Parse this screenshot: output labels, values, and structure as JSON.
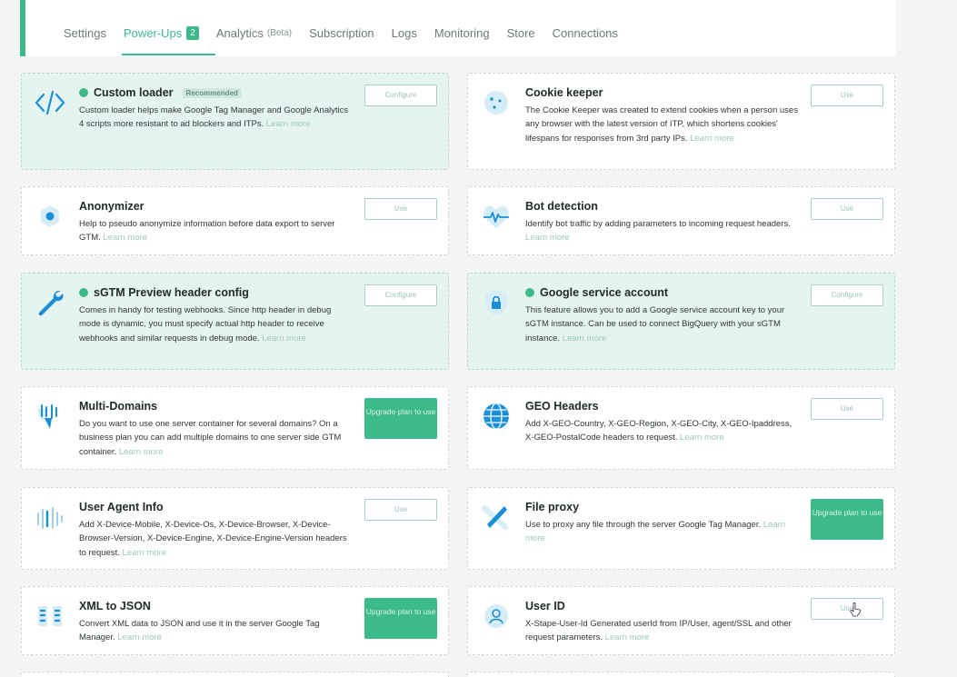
{
  "tabs": [
    {
      "label": "Settings"
    },
    {
      "label": "Power-Ups",
      "badge": "2"
    },
    {
      "label": "Analytics",
      "suffix": "(Beta)"
    },
    {
      "label": "Subscription"
    },
    {
      "label": "Logs"
    },
    {
      "label": "Monitoring"
    },
    {
      "label": "Store"
    },
    {
      "label": "Connections"
    }
  ],
  "active_tab": "Power-Ups",
  "colors": {
    "accent": "#3dba8a",
    "active_card_bg": "#e6f4f0",
    "blue_icon": "#1a8fd8"
  },
  "learn_more": "Learn more",
  "cards": [
    {
      "title": "Custom loader",
      "tag": "Recommended",
      "status": "enabled",
      "icon": "code-icon",
      "desc": "Custom loader helps make Google Tag Manager and Google Analytics 4 scripts more resistant to ad blockers and ITPs.",
      "button": "Configure"
    },
    {
      "title": "Cookie keeper",
      "status": "disabled",
      "icon": "cookie-icon",
      "desc": "The Cookie Keeper was created to extend cookies when a person uses any browser with the latest version of ITP, which shortens cookies' lifespans for responses from 3rd party IPs.",
      "button": "Use"
    },
    {
      "title": "Anonymizer",
      "status": "disabled",
      "icon": "anonymizer-icon",
      "desc": "Help to pseudo anonymize information before data export to server GTM.",
      "button": "Use"
    },
    {
      "title": "Bot detection",
      "status": "disabled",
      "icon": "heartbeat-icon",
      "desc": "Identify bot traffic by adding parameters to incoming request headers.",
      "button": "Use"
    },
    {
      "title": "sGTM Preview header config",
      "status": "enabled",
      "icon": "wrench-icon",
      "desc": "Comes in handy for testing webhooks. Since http header in debug mode is dynamic, you must specify actual http header to receive webhooks and similar requests in debug mode.",
      "button": "Configure"
    },
    {
      "title": "Google service account",
      "status": "enabled",
      "icon": "shield-lock-icon",
      "desc": "This feature allows you to add a Google service account key to your sGTM instance. Can be used to connect BigQuery with your sGTM instance.",
      "button": "Configure"
    },
    {
      "title": "Multi-Domains",
      "status": "locked",
      "icon": "multi-domains-icon",
      "desc": "Do you want to use one server container for several domains? On a business plan you can add multiple domains to one server side GTM container.",
      "button": "Upgrade plan to use"
    },
    {
      "title": "GEO Headers",
      "status": "disabled",
      "icon": "globe-icon",
      "desc": "Add X-GEO-Country, X-GEO-Region, X-GEO-City, X-GEO-Ipaddress, X-GEO-PostalCode headers to request.",
      "button": "Use"
    },
    {
      "title": "User Agent Info",
      "status": "disabled",
      "icon": "user-agent-icon",
      "desc": "Add X-Device-Mobile, X-Device-Os, X-Device-Browser, X-Device-Browser-Version, X-Device-Engine, X-Device-Engine-Version headers to request.",
      "button": "Use"
    },
    {
      "title": "File proxy",
      "status": "locked",
      "icon": "file-proxy-icon",
      "desc": "Use to proxy any file through the server Google Tag Manager.",
      "button": "Upgrade plan to use"
    },
    {
      "title": "XML to JSON",
      "status": "locked",
      "icon": "xml-json-icon",
      "desc": "Convert XML data to JSON and use it in the server Google Tag Manager.",
      "button": "Upgrade plan to use"
    },
    {
      "title": "User ID",
      "status": "disabled",
      "icon": "user-id-icon",
      "desc": "X-Stape-User-Id Generated userId from IP/User, agent/SSL and other request parameters.",
      "button": "Use"
    }
  ]
}
